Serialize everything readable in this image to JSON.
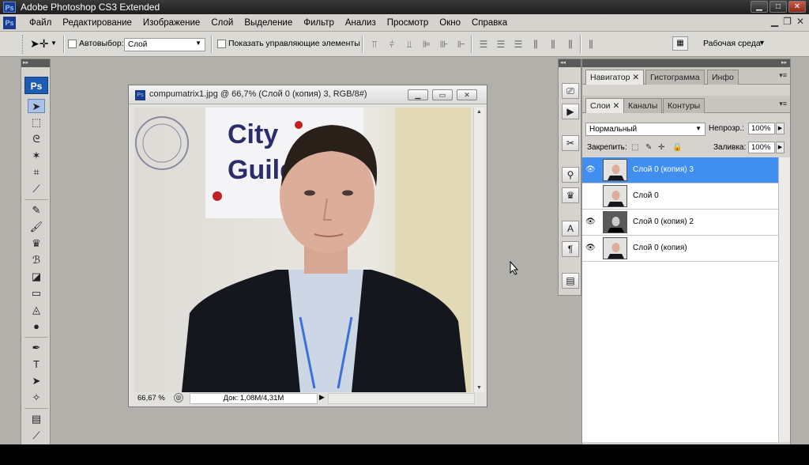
{
  "app": {
    "title": "Adobe Photoshop CS3 Extended",
    "logo": "Ps"
  },
  "menu": [
    "Файл",
    "Редактирование",
    "Изображение",
    "Слой",
    "Выделение",
    "Фильтр",
    "Анализ",
    "Просмотр",
    "Окно",
    "Справка"
  ],
  "options": {
    "autoselect_label": "Автовыбор:",
    "autoselect_value": "Слой",
    "show_controls_label": "Показать управляющие элементы",
    "workspace_label": "Рабочая среда"
  },
  "document": {
    "title": "compumatrix1.jpg @ 66,7% (Слой 0 (копия) 3, RGB/8#)",
    "zoom": "66,67 %",
    "doc_size": "Док: 1,08M/4,31M",
    "photo_sign_line1": "City",
    "photo_sign_line2": "Guilds"
  },
  "panels": {
    "top_tabs": [
      "Навигатор",
      "Гистограмма",
      "Инфо"
    ],
    "layer_tabs": [
      "Слои",
      "Каналы",
      "Контуры"
    ],
    "blend_mode": "Нормальный",
    "opacity_label": "Непрозр.:",
    "opacity_value": "100%",
    "lock_label": "Закрепить:",
    "fill_label": "Заливка:",
    "fill_value": "100%",
    "layers": [
      {
        "name": "Слой 0 (копия) 3",
        "selected": true
      },
      {
        "name": "Слой 0",
        "selected": false
      },
      {
        "name": "Слой 0 (копия) 2",
        "selected": false
      },
      {
        "name": "Слой 0 (копия)",
        "selected": false
      }
    ]
  },
  "colors": {
    "selection": "#3f8ef0",
    "workspace": "#b2b0ab",
    "panel": "#d6d3ce"
  }
}
